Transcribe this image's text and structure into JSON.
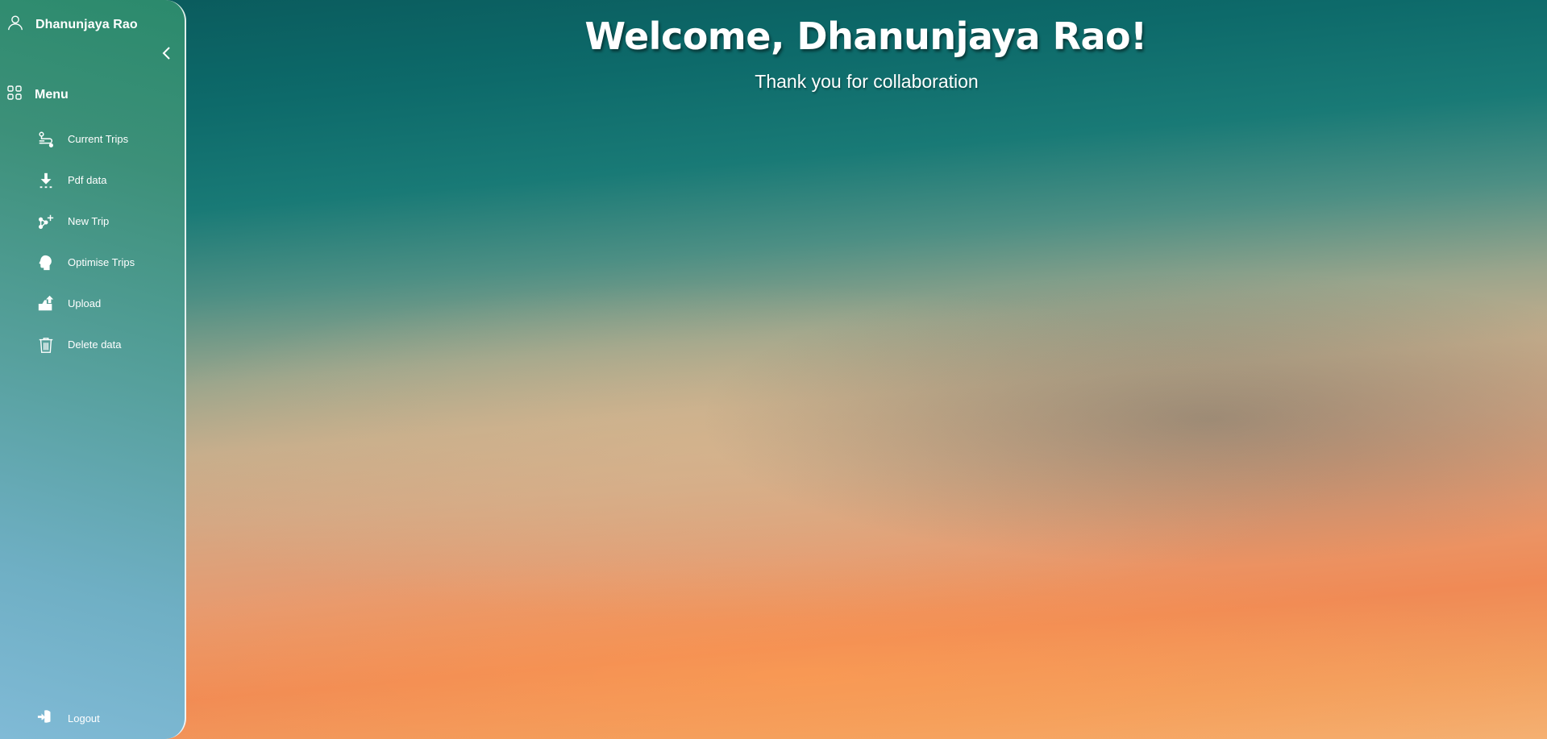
{
  "user": {
    "name": "Dhanunjaya Rao",
    "icon": "user-icon"
  },
  "sidebar": {
    "collapse_icon": "chevron-left-icon",
    "menu": {
      "title": "Menu",
      "icon": "grid-icon"
    },
    "items": [
      {
        "label": "Current Trips",
        "icon": "trips-icon"
      },
      {
        "label": "Pdf data",
        "icon": "download-icon"
      },
      {
        "label": "New Trip",
        "icon": "new-trip-icon"
      },
      {
        "label": "Optimise Trips",
        "icon": "head-icon"
      },
      {
        "label": "Upload",
        "icon": "upload-icon"
      },
      {
        "label": "Delete data",
        "icon": "trash-icon"
      }
    ],
    "logout": {
      "label": "Logout",
      "icon": "logout-icon"
    }
  },
  "main": {
    "title": "Welcome, Dhanunjaya Rao!",
    "subtitle": "Thank you for collaboration"
  },
  "colors": {
    "text": "#ffffff",
    "sidebar_top": "#2b8a6c",
    "sidebar_bottom": "#80bad6",
    "sky_top": "#0a5a5c",
    "sky_bottom": "#f5b071"
  }
}
